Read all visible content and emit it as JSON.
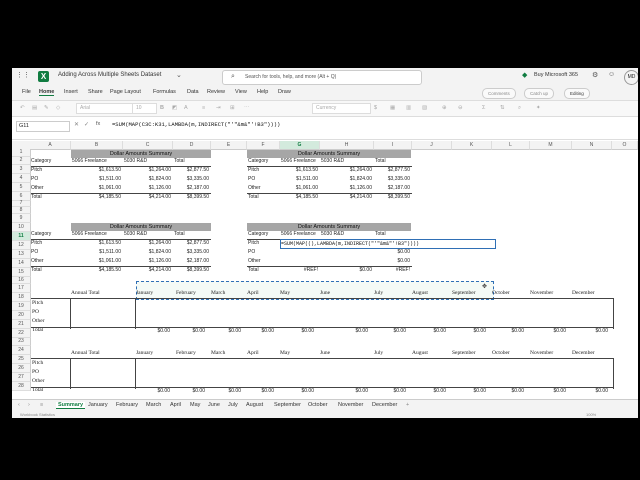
{
  "title_bar": {
    "doc_title": "Adding Across Multiple Sheets Dataset",
    "search_placeholder": "Search for tools, help, and more (Alt + Q)",
    "buy_label": "Buy Microsoft 365",
    "avatar_initials": "MD"
  },
  "ribbon": {
    "tabs": [
      "File",
      "Home",
      "Insert",
      "Share",
      "Page Layout",
      "Formulas",
      "Data",
      "Review",
      "View",
      "Help",
      "Draw"
    ],
    "active_tab": "Home",
    "comments_label": "Comments",
    "catchup_label": "Catch up",
    "editing_label": "Editing"
  },
  "toolbar": {
    "font_name": "Arial",
    "font_size": "10",
    "number_format": "Currency"
  },
  "formula_bar": {
    "cell_ref": "G11",
    "fx": "fx",
    "formula": "=SUM(MAP(C3C:K31,LAMBDA(m,INDIRECT(\"'\"&m&\"'!B3\"))))"
  },
  "grid": {
    "columns": [
      "A",
      "B",
      "C",
      "D",
      "E",
      "F",
      "G",
      "H",
      "I",
      "J",
      "K",
      "L",
      "M",
      "N",
      "O"
    ],
    "selected_column": "G",
    "rows": [
      "1",
      "2",
      "3",
      "4",
      "5",
      "6",
      "7",
      "8",
      "9",
      "10",
      "11",
      "12",
      "13",
      "14",
      "15",
      "16",
      "17",
      "18",
      "19",
      "20",
      "21",
      "22",
      "23",
      "24",
      "25",
      "26",
      "27",
      "28"
    ],
    "selected_row": "11",
    "summary_blocks": [
      {
        "title": "Dollar Amounts Summary",
        "headers": [
          "Category",
          "5066 Freelance",
          "5030 R&D",
          "Total"
        ],
        "rows": [
          [
            "Pitch",
            "$1,613.50",
            "$1,264.00",
            "$2,877.50"
          ],
          [
            "PO",
            "$1,511.00",
            "$1,824.00",
            "$3,335.00"
          ],
          [
            "Other",
            "$1,061.00",
            "$1,126.00",
            "$2,187.00"
          ],
          [
            "Total",
            "$4,185.50",
            "$4,214.00",
            "$8,399.50"
          ]
        ]
      },
      {
        "title": "Dollar Amounts Summary",
        "headers": [
          "Category",
          "5066 Freelance",
          "5030 R&D",
          "Total"
        ],
        "rows": [
          [
            "Pitch",
            "$1,613.50",
            "$1,264.00",
            "$2,877.50"
          ],
          [
            "PO",
            "$1,511.00",
            "$1,824.00",
            "$3,335.00"
          ],
          [
            "Other",
            "$1,061.00",
            "$1,126.00",
            "$2,187.00"
          ],
          [
            "Total",
            "$4,185.50",
            "$4,214.00",
            "$8,399.50"
          ]
        ]
      },
      {
        "title": "Dollar Amounts Summary",
        "headers": [
          "Category",
          "5066 Freelance",
          "5030 R&D",
          "Total"
        ],
        "rows": [
          [
            "Pitch",
            "$1,613.50",
            "$1,264.00",
            "$2,877.50"
          ],
          [
            "PO",
            "$1,511.00",
            "$1,824.00",
            "$3,335.00"
          ],
          [
            "Other",
            "$1,061.00",
            "$1,126.00",
            "$2,187.00"
          ],
          [
            "Total",
            "$4,185.50",
            "$4,214.00",
            "$8,399.50"
          ]
        ]
      },
      {
        "title": "Dollar Amounts Summary",
        "headers": [
          "Category",
          "5066 Freelance",
          "5030 R&D",
          "Total"
        ],
        "rows": [
          [
            "Pitch",
            "=SUM(MAP((),LAMBDA(m,INDIRECT(\"'\"&m&\"'!B3\"))))",
            "",
            ""
          ],
          [
            "PO",
            "",
            "",
            "$0.00"
          ],
          [
            "Other",
            "",
            "",
            "$0.00"
          ],
          [
            "Total",
            "#REF!",
            "$0.00",
            "#REF!"
          ]
        ]
      }
    ],
    "annual": {
      "headers": [
        "Annual Total",
        "January",
        "February",
        "March",
        "April",
        "May",
        "June",
        "July",
        "August",
        "September",
        "October",
        "November",
        "December"
      ],
      "labels": [
        "Pitch",
        "PO",
        "Other",
        "Total"
      ],
      "total_values": [
        "$0.00",
        "$0.00",
        "$0.00",
        "$0.00",
        "$0.00",
        "$0.00",
        "$0.00",
        "$0.00",
        "$0.00",
        "$0.00",
        "$0.00",
        "$0.00"
      ]
    }
  },
  "sheet_tabs": {
    "tabs": [
      "Summary",
      "January",
      "February",
      "March",
      "April",
      "May",
      "June",
      "July",
      "August",
      "September",
      "October",
      "November",
      "December"
    ],
    "active": "Summary"
  },
  "status_bar": {
    "left": "Workbook Statistics",
    "zoom": "100%"
  }
}
